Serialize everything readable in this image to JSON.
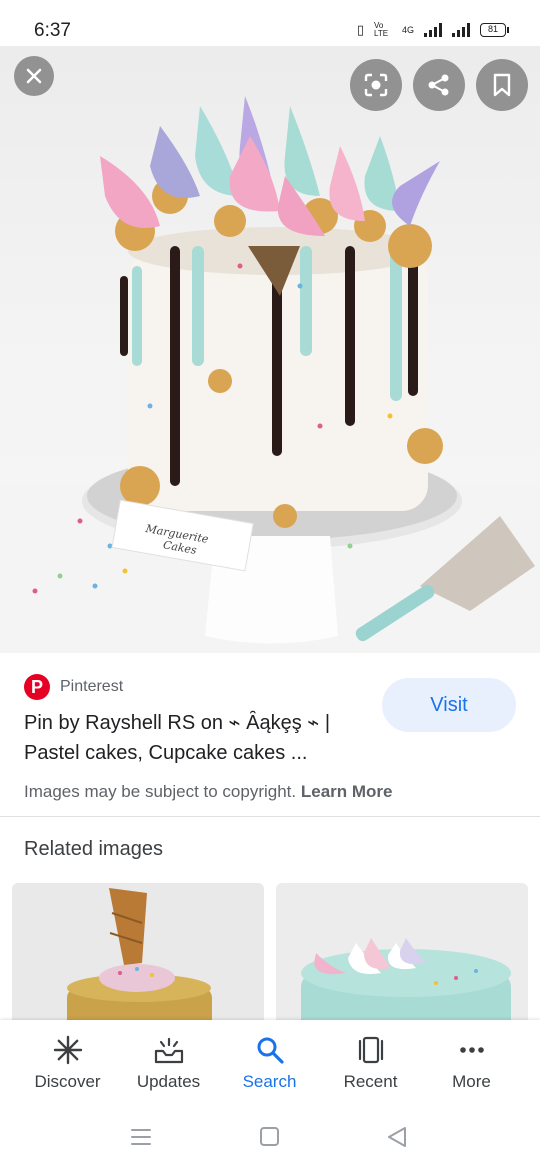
{
  "status": {
    "time": "6:37",
    "volte": "Vo LTE",
    "network": "4G",
    "battery": "81"
  },
  "hero": {
    "close_icon": "close-icon",
    "lens_icon": "lens-icon",
    "share_icon": "share-icon",
    "bookmark_icon": "bookmark-icon",
    "card_text_line1": "Marguerite",
    "card_text_line2": "Cakes"
  },
  "info": {
    "source": "Pinterest",
    "visit_label": "Visit",
    "title": "Pin by Rayshell RS on ⌁ Ȃąkȩş ⌁ | Pastel cakes, Cupcake cakes ...",
    "copyright_text": "Images may be subject to copyright.",
    "learn_more": "Learn More"
  },
  "related": {
    "title": "Related images"
  },
  "nav": {
    "items": [
      {
        "label": "Discover",
        "icon": "asterisk-icon"
      },
      {
        "label": "Updates",
        "icon": "updates-icon"
      },
      {
        "label": "Search",
        "icon": "search-icon"
      },
      {
        "label": "Recent",
        "icon": "recent-icon"
      },
      {
        "label": "More",
        "icon": "more-icon"
      }
    ],
    "active_color": "#1a73e8"
  }
}
